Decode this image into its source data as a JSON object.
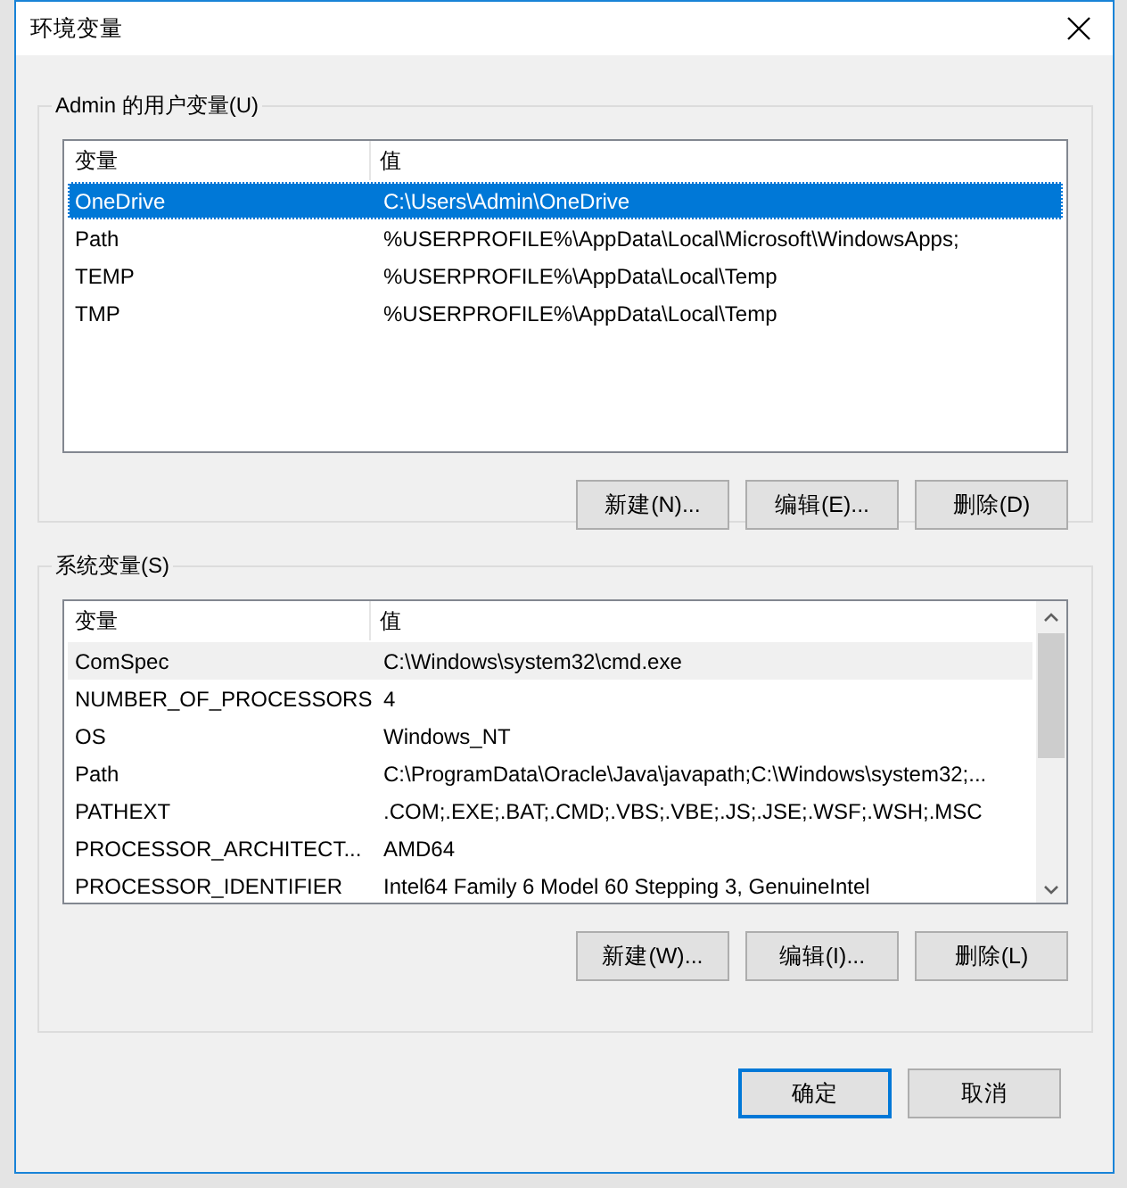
{
  "window": {
    "title": "环境变量"
  },
  "user_variables": {
    "title": "Admin 的用户变量(U)",
    "focused": true,
    "columns": [
      "变量",
      "值"
    ],
    "rows": [
      {
        "name": "OneDrive",
        "value": "C:\\Users\\Admin\\OneDrive",
        "selected": true
      },
      {
        "name": "Path",
        "value": "%USERPROFILE%\\AppData\\Local\\Microsoft\\WindowsApps;",
        "selected": false
      },
      {
        "name": "TEMP",
        "value": "%USERPROFILE%\\AppData\\Local\\Temp",
        "selected": false
      },
      {
        "name": "TMP",
        "value": "%USERPROFILE%\\AppData\\Local\\Temp",
        "selected": false
      }
    ],
    "buttons": [
      "新建(N)...",
      "编辑(E)...",
      "删除(D)"
    ]
  },
  "system_variables": {
    "title": "系统变量(S)",
    "focused": false,
    "columns": [
      "变量",
      "值"
    ],
    "rows": [
      {
        "name": "ComSpec",
        "value": "C:\\Windows\\system32\\cmd.exe",
        "selected": true
      },
      {
        "name": "NUMBER_OF_PROCESSORS",
        "value": "4",
        "selected": false
      },
      {
        "name": "OS",
        "value": "Windows_NT",
        "selected": false
      },
      {
        "name": "Path",
        "value": "C:\\ProgramData\\Oracle\\Java\\javapath;C:\\Windows\\system32;...",
        "selected": false
      },
      {
        "name": "PATHEXT",
        "value": ".COM;.EXE;.BAT;.CMD;.VBS;.VBE;.JS;.JSE;.WSF;.WSH;.MSC",
        "selected": false
      },
      {
        "name": "PROCESSOR_ARCHITECT...",
        "value": "AMD64",
        "selected": false
      },
      {
        "name": "PROCESSOR_IDENTIFIER",
        "value": "Intel64 Family 6 Model 60 Stepping 3, GenuineIntel",
        "selected": false
      }
    ],
    "buttons": [
      "新建(W)...",
      "编辑(I)...",
      "删除(L)"
    ]
  },
  "footer_buttons": [
    {
      "label": "确定",
      "default": true
    },
    {
      "label": "取消",
      "default": false
    }
  ]
}
